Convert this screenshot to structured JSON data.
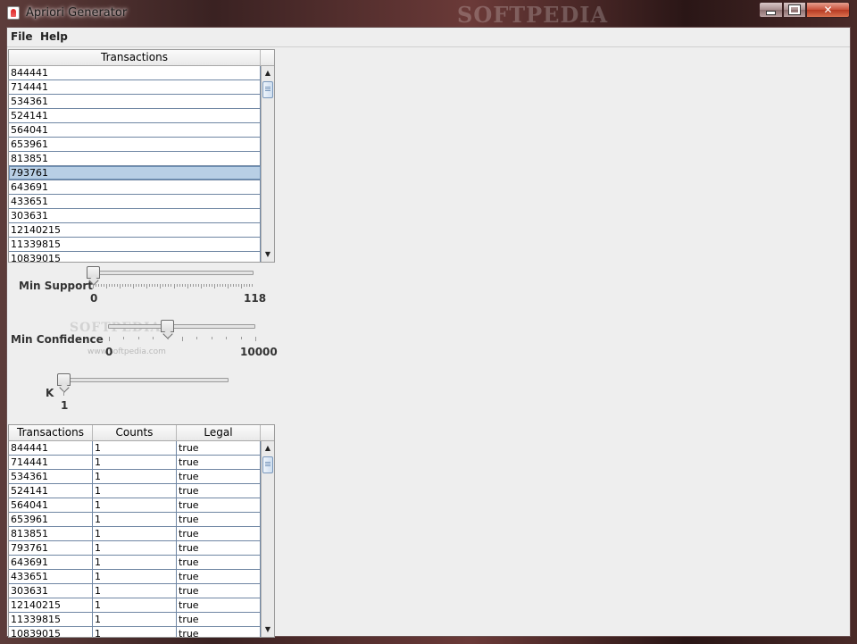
{
  "window": {
    "title": "Apriori Generator",
    "watermark": "SOFTPEDIA",
    "controls": {
      "minimize": "minimize-icon",
      "maximize": "maximize-icon",
      "close": "close-icon"
    }
  },
  "menu": {
    "items": [
      "File",
      "Help"
    ]
  },
  "transactions_table": {
    "header": "Transactions",
    "rows": [
      "844441",
      "714441",
      "534361",
      "524141",
      "564041",
      "653961",
      "813851",
      "793761",
      "643691",
      "433651",
      "303631",
      "12140215",
      "11339815",
      "10839015"
    ],
    "selected_value": "793761"
  },
  "sliders": {
    "min_support": {
      "label": "Min Support",
      "min": "0",
      "max": "118",
      "value": 0
    },
    "min_confidence": {
      "label": "Min Confidence",
      "min": "0",
      "max": "10000",
      "value": 0.4,
      "watermark": "SOFTPEDIA",
      "watermark_url": "www.softpedia.com"
    },
    "k": {
      "label": "K",
      "value_label": "1"
    }
  },
  "results_table": {
    "columns": [
      "Transactions",
      "Counts",
      "Legal"
    ],
    "rows": [
      [
        "844441",
        "1",
        "true"
      ],
      [
        "714441",
        "1",
        "true"
      ],
      [
        "534361",
        "1",
        "true"
      ],
      [
        "524141",
        "1",
        "true"
      ],
      [
        "564041",
        "1",
        "true"
      ],
      [
        "653961",
        "1",
        "true"
      ],
      [
        "813851",
        "1",
        "true"
      ],
      [
        "793761",
        "1",
        "true"
      ],
      [
        "643691",
        "1",
        "true"
      ],
      [
        "433651",
        "1",
        "true"
      ],
      [
        "303631",
        "1",
        "true"
      ],
      [
        "12140215",
        "1",
        "true"
      ],
      [
        "11339815",
        "1",
        "true"
      ],
      [
        "10839015",
        "1",
        "true"
      ]
    ]
  },
  "colors": {
    "selection": "#b8cfe5",
    "grid_line": "#6f86a3",
    "panel": "#eeeeee"
  }
}
